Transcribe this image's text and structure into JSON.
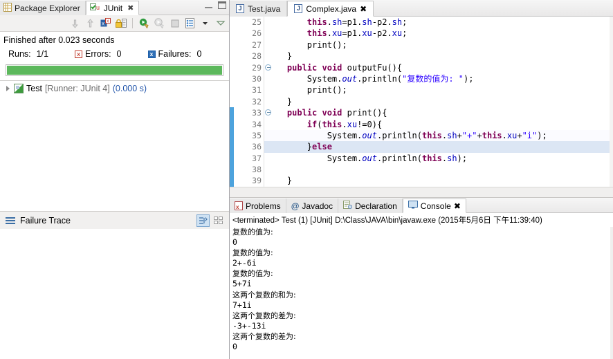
{
  "left_panel": {
    "tabs": [
      {
        "label": "Package Explorer",
        "icon": "package-explorer-icon",
        "active": false,
        "closeable": false
      },
      {
        "label": "JUnit",
        "icon": "junit-icon",
        "active": true,
        "closeable": true
      }
    ],
    "window_controls": {
      "minimize": "minimize-icon",
      "maximize": "maximize-icon"
    },
    "toolbar_icons": [
      "next-failure-icon",
      "previous-failure-icon",
      "show-failures-only-icon",
      "lock-scroll-icon",
      "rerun-test-icon",
      "rerun-test-failures-icon",
      "stop-icon",
      "test-run-history-icon",
      "view-menu-dropdown-icon",
      "view-menu-icon"
    ],
    "status": "Finished after 0.023 seconds",
    "counters": {
      "runs_label": "Runs:",
      "runs_value": "1/1",
      "errors_label": "Errors:",
      "errors_value": "0",
      "failures_label": "Failures:",
      "failures_value": "0"
    },
    "progress": {
      "percent": 100,
      "color": "#5cb85c"
    },
    "tree": [
      {
        "name": "Test",
        "runner": "[Runner: JUnit 4]",
        "time": "(0.000 s)"
      }
    ],
    "failure_trace": {
      "title": "Failure Trace",
      "actions": [
        "show-stack-trace-filter-icon",
        "compare-result-icon"
      ]
    }
  },
  "editor": {
    "tabs": [
      {
        "label": "Test.java",
        "icon": "java-file-icon",
        "active": false,
        "closeable": false
      },
      {
        "label": "Complex.java",
        "icon": "java-file-icon",
        "active": true,
        "closeable": true
      }
    ],
    "first_line_number": 25,
    "lines": [
      {
        "n": 25,
        "fold": false,
        "changed": false,
        "hl": "none",
        "tokens": [
          {
            "t": "        ",
            "c": "pl"
          },
          {
            "t": "this",
            "c": "kw"
          },
          {
            "t": ".",
            "c": "pl"
          },
          {
            "t": "sh",
            "c": "fld"
          },
          {
            "t": "=p1.",
            "c": "pl"
          },
          {
            "t": "sh",
            "c": "fld"
          },
          {
            "t": "-p2.",
            "c": "pl"
          },
          {
            "t": "sh",
            "c": "fld"
          },
          {
            "t": ";",
            "c": "pl"
          }
        ]
      },
      {
        "n": 26,
        "fold": false,
        "changed": false,
        "hl": "none",
        "tokens": [
          {
            "t": "        ",
            "c": "pl"
          },
          {
            "t": "this",
            "c": "kw"
          },
          {
            "t": ".",
            "c": "pl"
          },
          {
            "t": "xu",
            "c": "fld"
          },
          {
            "t": "=p1.",
            "c": "pl"
          },
          {
            "t": "xu",
            "c": "fld"
          },
          {
            "t": "-p2.",
            "c": "pl"
          },
          {
            "t": "xu",
            "c": "fld"
          },
          {
            "t": ";",
            "c": "pl"
          }
        ]
      },
      {
        "n": 27,
        "fold": false,
        "changed": false,
        "hl": "none",
        "tokens": [
          {
            "t": "        print();",
            "c": "pl"
          }
        ]
      },
      {
        "n": 28,
        "fold": false,
        "changed": false,
        "hl": "none",
        "tokens": [
          {
            "t": "    }",
            "c": "pl"
          }
        ]
      },
      {
        "n": 29,
        "fold": true,
        "changed": false,
        "hl": "none",
        "tokens": [
          {
            "t": "    ",
            "c": "pl"
          },
          {
            "t": "public",
            "c": "kw"
          },
          {
            "t": " ",
            "c": "pl"
          },
          {
            "t": "void",
            "c": "kw"
          },
          {
            "t": " outputFu(){",
            "c": "pl"
          }
        ]
      },
      {
        "n": 30,
        "fold": false,
        "changed": false,
        "hl": "none",
        "tokens": [
          {
            "t": "        System.",
            "c": "pl"
          },
          {
            "t": "out",
            "c": "sf"
          },
          {
            "t": ".println(",
            "c": "pl"
          },
          {
            "t": "\"复数的值为: \"",
            "c": "st"
          },
          {
            "t": ");",
            "c": "pl"
          }
        ]
      },
      {
        "n": 31,
        "fold": false,
        "changed": false,
        "hl": "none",
        "tokens": [
          {
            "t": "        print();",
            "c": "pl"
          }
        ]
      },
      {
        "n": 32,
        "fold": false,
        "changed": false,
        "hl": "none",
        "tokens": [
          {
            "t": "    }",
            "c": "pl"
          }
        ]
      },
      {
        "n": 33,
        "fold": true,
        "changed": true,
        "hl": "none",
        "tokens": [
          {
            "t": "    ",
            "c": "pl"
          },
          {
            "t": "public",
            "c": "kw"
          },
          {
            "t": " ",
            "c": "pl"
          },
          {
            "t": "void",
            "c": "kw"
          },
          {
            "t": " print(){",
            "c": "pl"
          }
        ]
      },
      {
        "n": 34,
        "fold": false,
        "changed": true,
        "hl": "none",
        "tokens": [
          {
            "t": "        ",
            "c": "pl"
          },
          {
            "t": "if",
            "c": "kw"
          },
          {
            "t": "(",
            "c": "pl"
          },
          {
            "t": "this",
            "c": "kw"
          },
          {
            "t": ".",
            "c": "pl"
          },
          {
            "t": "xu",
            "c": "fld"
          },
          {
            "t": "!=0){",
            "c": "pl"
          }
        ]
      },
      {
        "n": 35,
        "fold": false,
        "changed": true,
        "hl": "soft",
        "tokens": [
          {
            "t": "            System.",
            "c": "pl"
          },
          {
            "t": "out",
            "c": "sf"
          },
          {
            "t": ".println(",
            "c": "pl"
          },
          {
            "t": "this",
            "c": "kw"
          },
          {
            "t": ".",
            "c": "pl"
          },
          {
            "t": "sh",
            "c": "fld"
          },
          {
            "t": "+",
            "c": "pl"
          },
          {
            "t": "\"+\"",
            "c": "st"
          },
          {
            "t": "+",
            "c": "pl"
          },
          {
            "t": "this",
            "c": "kw"
          },
          {
            "t": ".",
            "c": "pl"
          },
          {
            "t": "xu",
            "c": "fld"
          },
          {
            "t": "+",
            "c": "pl"
          },
          {
            "t": "\"i\"",
            "c": "st"
          },
          {
            "t": ");",
            "c": "pl"
          }
        ]
      },
      {
        "n": 36,
        "fold": false,
        "changed": true,
        "hl": "cursor",
        "tokens": [
          {
            "t": "        }",
            "c": "pl"
          },
          {
            "t": "else",
            "c": "kw"
          }
        ]
      },
      {
        "n": 37,
        "fold": false,
        "changed": true,
        "hl": "none",
        "tokens": [
          {
            "t": "            System.",
            "c": "pl"
          },
          {
            "t": "out",
            "c": "sf"
          },
          {
            "t": ".println(",
            "c": "pl"
          },
          {
            "t": "this",
            "c": "kw"
          },
          {
            "t": ".",
            "c": "pl"
          },
          {
            "t": "sh",
            "c": "fld"
          },
          {
            "t": ");",
            "c": "pl"
          }
        ]
      },
      {
        "n": 38,
        "fold": false,
        "changed": true,
        "hl": "none",
        "tokens": []
      },
      {
        "n": 39,
        "fold": false,
        "changed": true,
        "hl": "none",
        "tokens": [
          {
            "t": "    }",
            "c": "pl"
          }
        ]
      }
    ]
  },
  "console_panel": {
    "tabs": [
      {
        "label": "Problems",
        "icon": "problems-icon",
        "active": false,
        "closeable": false
      },
      {
        "label": "Javadoc",
        "icon": "javadoc-icon",
        "active": false,
        "closeable": false
      },
      {
        "label": "Declaration",
        "icon": "declaration-icon",
        "active": false,
        "closeable": false
      },
      {
        "label": "Console",
        "icon": "console-icon",
        "active": true,
        "closeable": true
      }
    ],
    "terminated_line": "<terminated> Test (1) [JUnit] D:\\Class\\JAVA\\bin\\javaw.exe (2015年5月6日 下午11:39:40)",
    "output": [
      {
        "text": "复数的值为:",
        "cjk": true
      },
      {
        "text": "0",
        "cjk": false
      },
      {
        "text": "复数的值为:",
        "cjk": true
      },
      {
        "text": "2+-6i",
        "cjk": false
      },
      {
        "text": "复数的值为:",
        "cjk": true
      },
      {
        "text": "5+7i",
        "cjk": false
      },
      {
        "text": "这两个复数的和为:",
        "cjk": true
      },
      {
        "text": "7+1i",
        "cjk": false
      },
      {
        "text": "这两个复数的差为:",
        "cjk": true
      },
      {
        "text": "-3+-13i",
        "cjk": false
      },
      {
        "text": "这两个复数的差为:",
        "cjk": true
      },
      {
        "text": "0",
        "cjk": false
      }
    ]
  }
}
